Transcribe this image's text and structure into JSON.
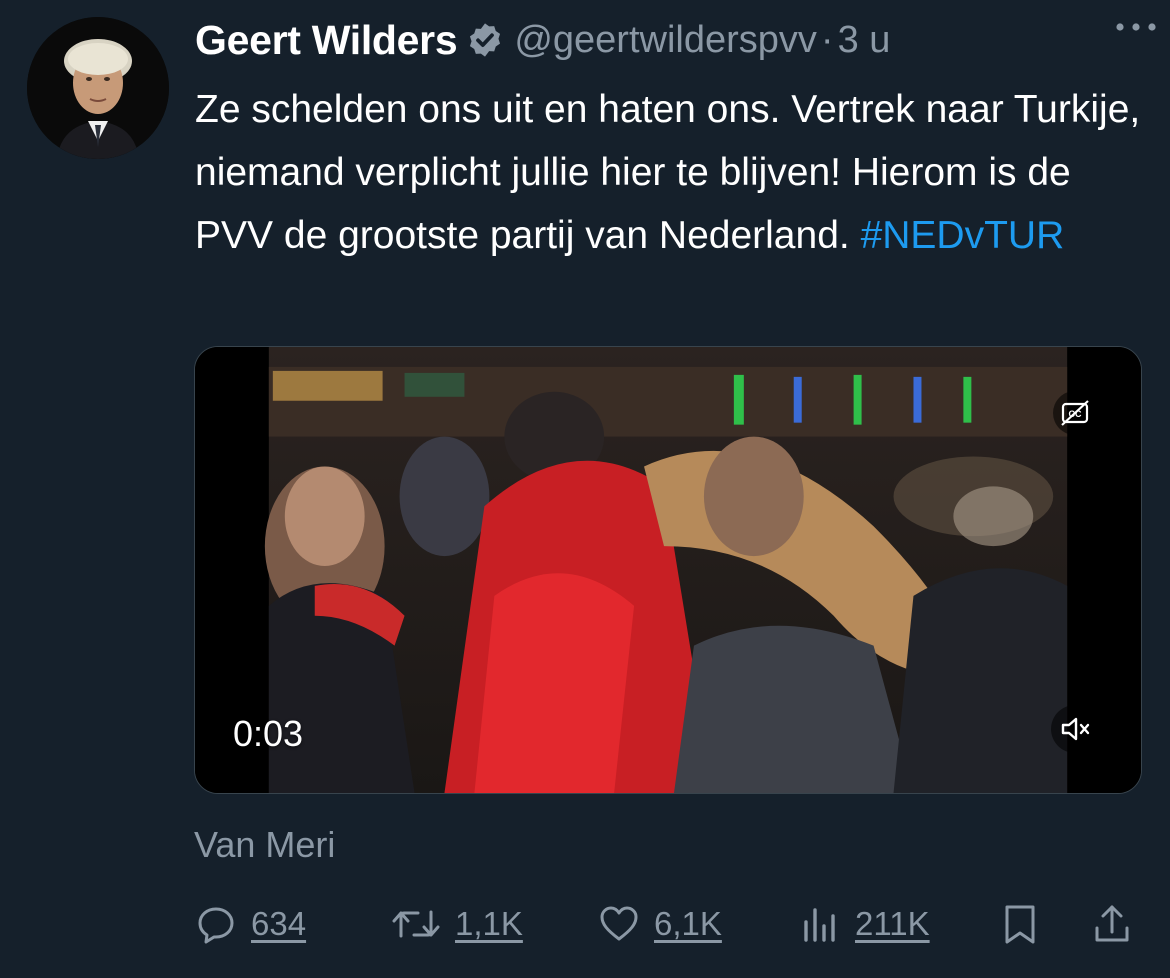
{
  "author": {
    "display_name": "Geert Wilders",
    "handle": "@geertwilderspvv",
    "separator": "·",
    "time": "3 u",
    "verified": true,
    "avatar_icon": "profile-photo"
  },
  "tweet": {
    "text": "Ze schelden ons uit en haten ons. Vertrek naar Turkije, niemand verplicht jullie hier te blijven! Hierom is de PVV de grootste partij van Nederland. ",
    "hashtag": "#NEDvTUR"
  },
  "media": {
    "type": "video",
    "duration": "0:03",
    "cc_icon": "closed-captions-icon",
    "mute_icon": "muted-speaker-icon"
  },
  "source_label": "Van Meri",
  "actions": {
    "reply_count": "634",
    "retweet_count": "1,1K",
    "like_count": "6,1K",
    "views_count": "211K"
  },
  "colors": {
    "background": "#15202b",
    "text": "#ffffff",
    "muted": "#8b98a5",
    "accent": "#1d9bf0"
  }
}
